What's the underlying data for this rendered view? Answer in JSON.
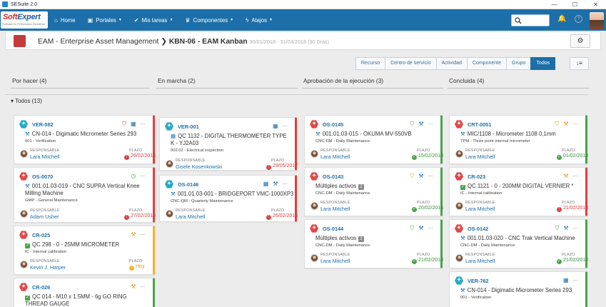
{
  "window": {
    "title": "SESuite 2.0",
    "controls": [
      "—",
      "☐",
      "✕"
    ]
  },
  "logo": {
    "brand_a": "Soft",
    "brand_b": "Expert",
    "tagline": "Software for Performance Excellence"
  },
  "nav": {
    "items": [
      {
        "label": "Home",
        "icon": "home-icon",
        "dropdown": false
      },
      {
        "label": "Portales",
        "icon": "briefcase-icon",
        "dropdown": true
      },
      {
        "label": "Mis tareas",
        "icon": "check-icon",
        "dropdown": true
      },
      {
        "label": "Componentes",
        "icon": "trophy-icon",
        "dropdown": true
      },
      {
        "label": "Atajos",
        "icon": "bolt-icon",
        "dropdown": true
      }
    ]
  },
  "header": {
    "module": "EAM - Enterprise Asset Management",
    "board": "KBN-06 - EAM Kanban",
    "dates": "30/01/2018 - 31/03/2018 (30 Días)"
  },
  "filters": {
    "items": [
      "Recurso",
      "Centro de servicio",
      "Actividad",
      "Componente",
      "Grupo",
      "Todos"
    ],
    "active": "Todos"
  },
  "columns": [
    {
      "title": "Por hacer (4)"
    },
    {
      "title": "En marcha (2)"
    },
    {
      "title": "Aprobación de la ejecución (3)"
    },
    {
      "title": "Concluida (4)"
    }
  ],
  "group": {
    "label": "Todos (13)"
  },
  "labels": {
    "responsible": "RESPONSABLE",
    "deadline": "PLAZO"
  },
  "colors": {
    "red": "#d94141",
    "green": "#49a447",
    "amber": "#f2b22c",
    "brand": "#1c6fa8"
  },
  "cards": [
    {
      "id": "VER-082",
      "type_color": "teal",
      "desc": "CN-014 - Digimatic Micrometer Series 293",
      "sub": "001 - Verification",
      "responsible": "Lara Mitchell",
      "deadline": "26/02/2018",
      "status": "red",
      "icons": [
        "shield-icon",
        "calendar-icon"
      ]
    },
    {
      "id": "OS-0070",
      "type_color": "red",
      "desc": "001.01.03-019 - CNC SUPRA Vertical Knee Milling Machine",
      "sub": "GMP - General Maintenance",
      "responsible": "Adam Usher",
      "deadline": "27/02/2018",
      "status": "red",
      "icons": [
        "clock-icon"
      ]
    },
    {
      "id": "CR-025",
      "type_color": "red",
      "desc": "QC 298 - 0 - 25MM MICROMETER",
      "sub": "IC - Internal calibration",
      "responsible": "Kevin J. Harper",
      "deadline": "Hoy",
      "status": "amber",
      "icons": [
        "wrench-icon"
      ]
    },
    {
      "id": "CR-026",
      "type_color": "red",
      "desc": "QC 014 - M10 x 1.5MM - 6g GO RING THREAD GAUGE",
      "status": "green",
      "icons": [
        "wrench-icon"
      ]
    },
    {
      "id": "VER-001",
      "type_color": "teal",
      "desc": "QC 1132 - DIGITAL THERMOMETER TYPE K - YJ2A03",
      "sub": "002.02 - Electrical inspection",
      "responsible": "Gisele Kosenkowski",
      "deadline": "29/05/2017",
      "status": "red",
      "icons": [
        "calendar-icon"
      ]
    },
    {
      "id": "OS-0146",
      "type_color": "teal",
      "desc": "001.01.03-001 - BRIDGEPORT VMC-1000XP3",
      "sub": "CNC-QM - Quarterly Maintenance",
      "responsible": "Lara Mitchell",
      "deadline": "26/02/2018",
      "status": "red",
      "icons": [
        "calendar-icon",
        "wrench-icon"
      ]
    },
    {
      "id": "OS-0145",
      "type_color": "red",
      "desc": "001.01.03-015 - OKUMA MV-550VB",
      "sub": "CNC-DM - Daily Maintenance",
      "responsible": "Lara Mitchell",
      "deadline": "15/02/2018",
      "status": "green",
      "icons": [
        "shield-icon",
        "wrench-icon"
      ]
    },
    {
      "id": "OS-0143",
      "type_color": "red",
      "desc": "Múltiples activos",
      "badge": "2",
      "sub": "CNC-DM - Daily Maintenance",
      "responsible": "Lara Mitchell",
      "deadline": "20/02/2018",
      "status": "green",
      "icons": [
        "shield-icon",
        "wrench-icon"
      ]
    },
    {
      "id": "OS-0144",
      "type_color": "red",
      "desc": "Múltiples activos",
      "badge": "2",
      "sub": "CNC-DM - Daily Maintenance",
      "responsible": "Lara Mitchell",
      "deadline": "21/02/2018",
      "status": "green",
      "icons": [
        "shield-icon",
        "wrench-icon"
      ]
    },
    {
      "id": "CRT-0051",
      "type_color": "red",
      "desc": "MIC/1108 - Micrometer 1108 0,1mm",
      "sub": "TPM - Three point internal micrometer",
      "responsible": "Lara Mitchell",
      "deadline": "01/02/2018",
      "status": "green",
      "icons": [
        "shield-icon",
        "wrench-icon"
      ]
    },
    {
      "id": "CR-023",
      "type_color": "red",
      "desc": "QC 1121 - 0 - 200MM DIGITAL VERNIER *",
      "sub": "IC - Internal calibration",
      "responsible": "Lara Mitchell",
      "deadline": "21/02/2018",
      "status": "red",
      "icons": [
        "wrench-icon"
      ]
    },
    {
      "id": "OS-0142",
      "type_color": "red",
      "desc": "001.01.03-020 - CNC Trak Vertical Machine",
      "sub": "CNC-DM - Daily Maintenance",
      "responsible": "Lara Mitchell",
      "deadline": "21/02/2018",
      "status": "green",
      "icons": [
        "shield-icon",
        "wrench-icon"
      ]
    },
    {
      "id": "VER-762",
      "type_color": "teal",
      "desc": "CN-014 - Digimatic Micrometer Series 293",
      "sub": "001 - Verification",
      "status": "green",
      "icons": [
        "calendar-icon"
      ]
    }
  ]
}
